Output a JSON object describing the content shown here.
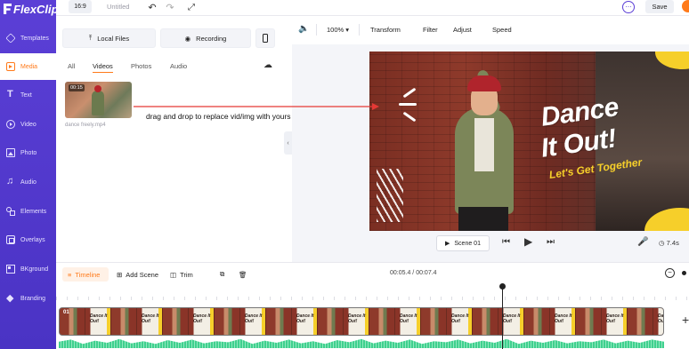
{
  "app": {
    "logo_text": "FlexClip"
  },
  "topbar": {
    "ratio": "16:9",
    "title": "Untitled",
    "save": "Save"
  },
  "sidebar": {
    "items": [
      {
        "label": "Templates",
        "icon": "templates-icon"
      },
      {
        "label": "Media",
        "icon": "media-icon",
        "active": true
      },
      {
        "label": "Text",
        "icon": "text-icon"
      },
      {
        "label": "Video",
        "icon": "video-icon"
      },
      {
        "label": "Photo",
        "icon": "photo-icon"
      },
      {
        "label": "Audio",
        "icon": "audio-icon"
      },
      {
        "label": "Elements",
        "icon": "elements-icon"
      },
      {
        "label": "Overlays",
        "icon": "overlays-icon"
      },
      {
        "label": "BKground",
        "icon": "background-icon"
      },
      {
        "label": "Branding",
        "icon": "branding-icon"
      }
    ]
  },
  "media": {
    "local_files": "Local Files",
    "recording": "Recording",
    "tabs": [
      "All",
      "Videos",
      "Photos",
      "Audio"
    ],
    "active_tab": "Videos",
    "thumb": {
      "duration": "00:15",
      "name": "dance freely.mp4"
    }
  },
  "preview_toolbar": {
    "zoom": "100%",
    "transform": "Transform",
    "filter": "Filter",
    "adjust": "Adjust",
    "speed": "Speed"
  },
  "video": {
    "title_line1": "Dance",
    "title_line2": "It Out!",
    "subtitle": "Let's Get Together"
  },
  "player": {
    "scene": "Scene 01",
    "duration": "7.4s"
  },
  "timeline": {
    "tab": "Timeline",
    "add_scene": "Add Scene",
    "trim": "Trim",
    "time": "00:05.4 / 00:07.4",
    "clip_label": "01"
  },
  "annotation": {
    "text": "drag and drop to replace vid/img with yours"
  },
  "colors": {
    "brand_purple": "#5b3fd6",
    "accent_orange": "#ff7a1a",
    "title_yellow": "#f6cf2a",
    "arrow_red": "#e53935"
  }
}
